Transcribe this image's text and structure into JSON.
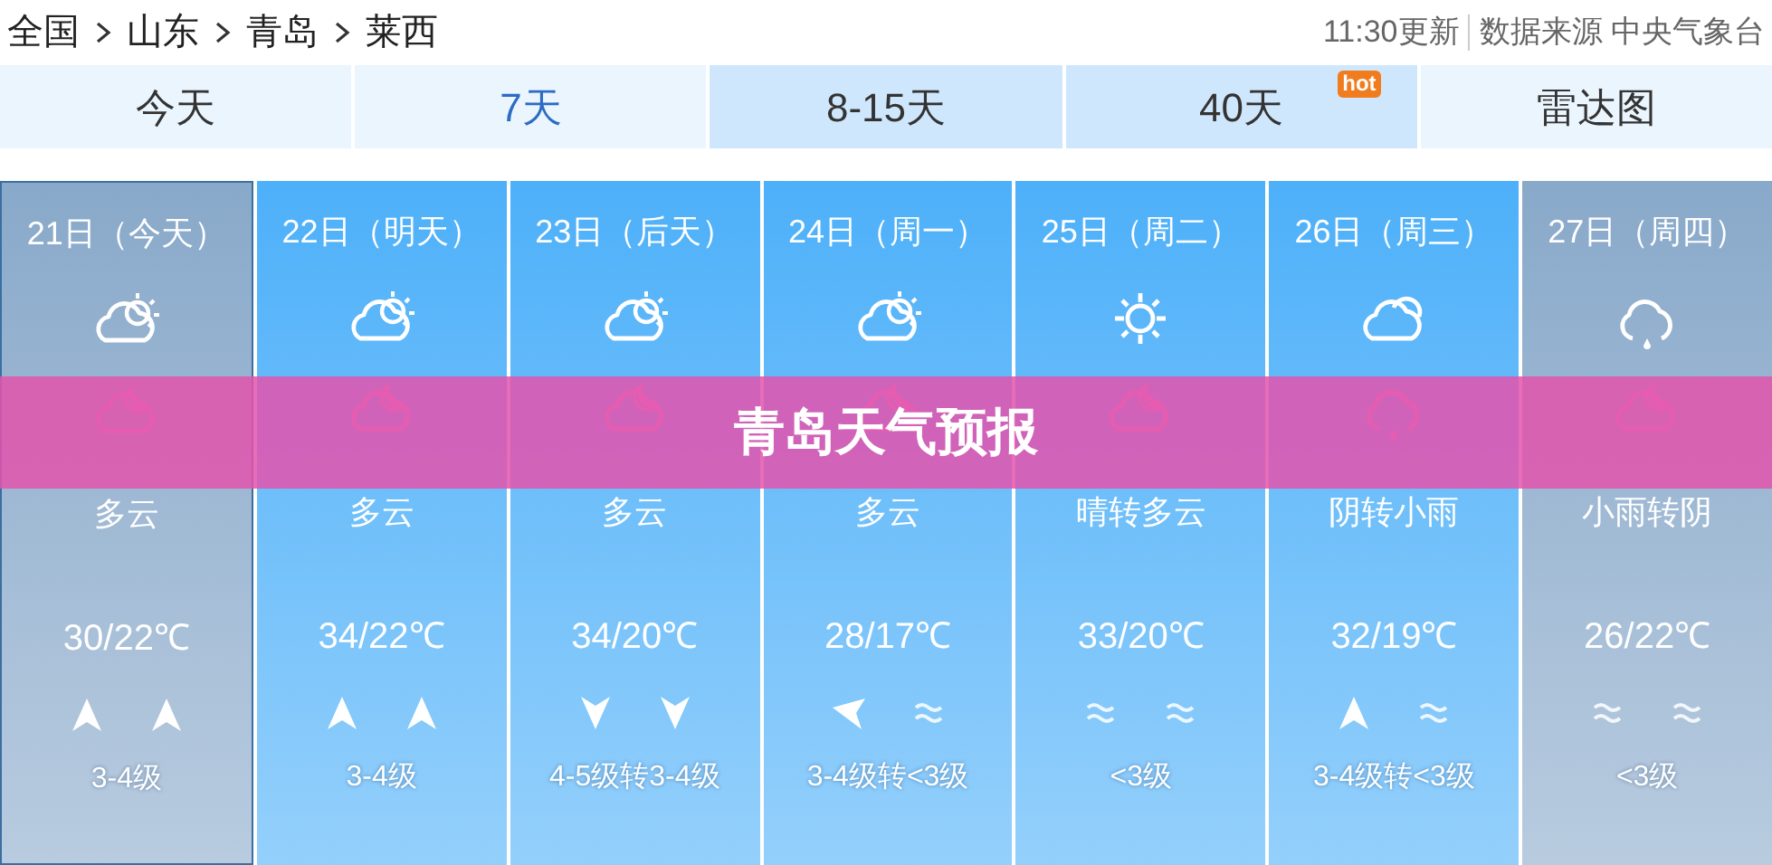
{
  "breadcrumb": [
    {
      "label": "全国"
    },
    {
      "label": "山东"
    },
    {
      "label": "青岛"
    },
    {
      "label": "莱西"
    }
  ],
  "update_time": "11:30更新",
  "source": "数据来源 中央气象台",
  "tabs": [
    {
      "label": "今天",
      "selected": false,
      "color": "#eaf5fe"
    },
    {
      "label": "7天",
      "selected": true,
      "color": "#eaf5fe"
    },
    {
      "label": "8-15天",
      "selected": false,
      "color": "#cfe7fc"
    },
    {
      "label": "40天",
      "selected": false,
      "color": "#cfe7fc",
      "badge": "hot"
    },
    {
      "label": "雷达图",
      "selected": false,
      "color": "#eaf5fe"
    }
  ],
  "days": [
    {
      "date": "21日（今天）",
      "selected": true,
      "color": "#89a9ca",
      "day_icon": {
        "kind": "partly-cloudy"
      },
      "night_icon": {
        "kind": "night-cloudy"
      },
      "weather": "多云",
      "temp": "30/22℃",
      "wind": [
        {
          "kind": "up"
        },
        {
          "kind": "up"
        }
      ],
      "wind_level": "3-4级"
    },
    {
      "date": "22日（明天）",
      "selected": false,
      "color": "#4db0f9",
      "day_icon": {
        "kind": "partly-cloudy"
      },
      "night_icon": {
        "kind": "night-cloudy"
      },
      "weather": "多云",
      "temp": "34/22℃",
      "wind": [
        {
          "kind": "up"
        },
        {
          "kind": "up"
        }
      ],
      "wind_level": "3-4级"
    },
    {
      "date": "23日（后天）",
      "selected": false,
      "color": "#4db0f9",
      "day_icon": {
        "kind": "partly-cloudy"
      },
      "night_icon": {
        "kind": "night-cloudy"
      },
      "weather": "多云",
      "temp": "34/20℃",
      "wind": [
        {
          "kind": "down"
        },
        {
          "kind": "down"
        }
      ],
      "wind_level": "4-5级转3-4级"
    },
    {
      "date": "24日（周一）",
      "selected": false,
      "color": "#4db0f9",
      "day_icon": {
        "kind": "partly-cloudy"
      },
      "night_icon": {
        "kind": "night-cloudy"
      },
      "weather": "多云",
      "temp": "28/17℃",
      "wind": [
        {
          "kind": "left"
        },
        {
          "kind": "calm"
        }
      ],
      "wind_level": "3-4级转<3级"
    },
    {
      "date": "25日（周二）",
      "selected": false,
      "color": "#4db0f9",
      "day_icon": {
        "kind": "sunny"
      },
      "night_icon": {
        "kind": "night-cloudy"
      },
      "weather": "晴转多云",
      "temp": "33/20℃",
      "wind": [
        {
          "kind": "calm"
        },
        {
          "kind": "calm"
        }
      ],
      "wind_level": "<3级"
    },
    {
      "date": "26日（周三）",
      "selected": false,
      "color": "#4db0f9",
      "day_icon": {
        "kind": "cloudy"
      },
      "night_icon": {
        "kind": "rain"
      },
      "weather": "阴转小雨",
      "temp": "32/19℃",
      "wind": [
        {
          "kind": "up"
        },
        {
          "kind": "calm"
        }
      ],
      "wind_level": "3-4级转<3级"
    },
    {
      "date": "27日（周四）",
      "selected": false,
      "color": "#89a9ca",
      "day_icon": {
        "kind": "rain"
      },
      "night_icon": {
        "kind": "night-cloudy"
      },
      "weather": "小雨转阴",
      "temp": "26/22℃",
      "wind": [
        {
          "kind": "calm"
        },
        {
          "kind": "calm"
        }
      ],
      "wind_level": "<3级"
    }
  ],
  "banner": "青岛天气预报"
}
